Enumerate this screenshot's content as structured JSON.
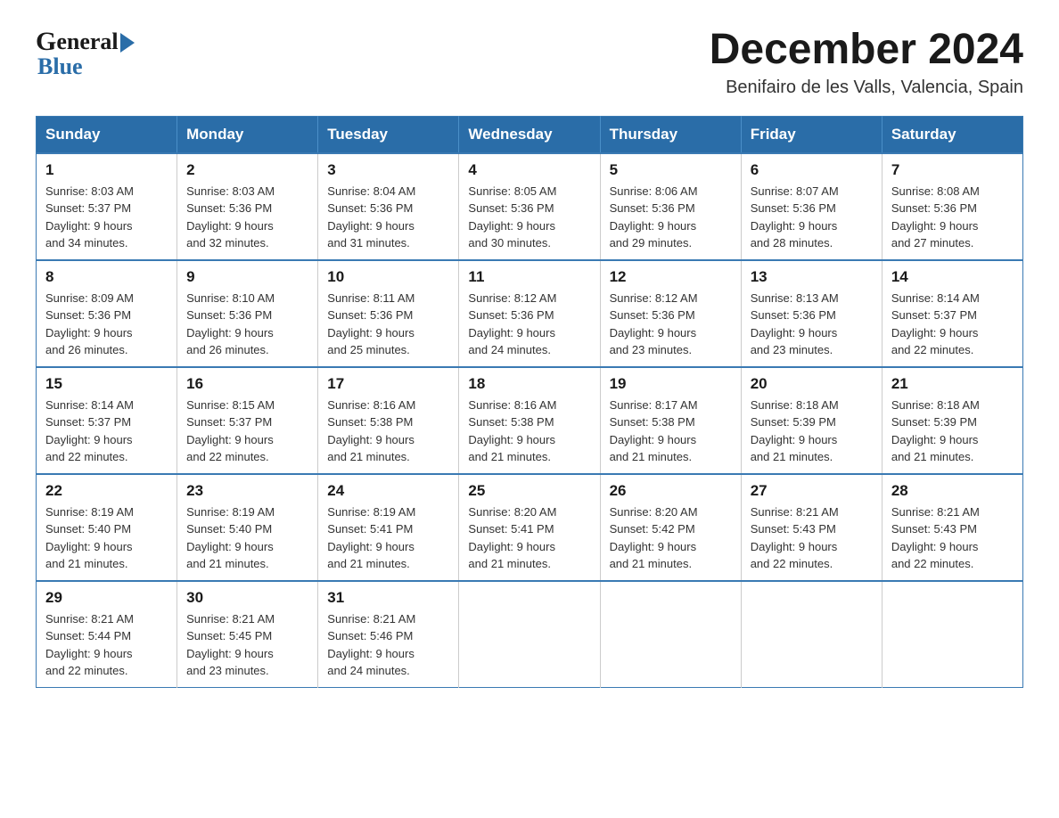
{
  "header": {
    "title": "December 2024",
    "subtitle": "Benifairo de les Valls, Valencia, Spain",
    "logo_general": "General",
    "logo_blue": "Blue"
  },
  "days_of_week": [
    "Sunday",
    "Monday",
    "Tuesday",
    "Wednesday",
    "Thursday",
    "Friday",
    "Saturday"
  ],
  "weeks": [
    [
      {
        "day": "1",
        "sunrise": "8:03 AM",
        "sunset": "5:37 PM",
        "daylight": "9 hours and 34 minutes."
      },
      {
        "day": "2",
        "sunrise": "8:03 AM",
        "sunset": "5:36 PM",
        "daylight": "9 hours and 32 minutes."
      },
      {
        "day": "3",
        "sunrise": "8:04 AM",
        "sunset": "5:36 PM",
        "daylight": "9 hours and 31 minutes."
      },
      {
        "day": "4",
        "sunrise": "8:05 AM",
        "sunset": "5:36 PM",
        "daylight": "9 hours and 30 minutes."
      },
      {
        "day": "5",
        "sunrise": "8:06 AM",
        "sunset": "5:36 PM",
        "daylight": "9 hours and 29 minutes."
      },
      {
        "day": "6",
        "sunrise": "8:07 AM",
        "sunset": "5:36 PM",
        "daylight": "9 hours and 28 minutes."
      },
      {
        "day": "7",
        "sunrise": "8:08 AM",
        "sunset": "5:36 PM",
        "daylight": "9 hours and 27 minutes."
      }
    ],
    [
      {
        "day": "8",
        "sunrise": "8:09 AM",
        "sunset": "5:36 PM",
        "daylight": "9 hours and 26 minutes."
      },
      {
        "day": "9",
        "sunrise": "8:10 AM",
        "sunset": "5:36 PM",
        "daylight": "9 hours and 26 minutes."
      },
      {
        "day": "10",
        "sunrise": "8:11 AM",
        "sunset": "5:36 PM",
        "daylight": "9 hours and 25 minutes."
      },
      {
        "day": "11",
        "sunrise": "8:12 AM",
        "sunset": "5:36 PM",
        "daylight": "9 hours and 24 minutes."
      },
      {
        "day": "12",
        "sunrise": "8:12 AM",
        "sunset": "5:36 PM",
        "daylight": "9 hours and 23 minutes."
      },
      {
        "day": "13",
        "sunrise": "8:13 AM",
        "sunset": "5:36 PM",
        "daylight": "9 hours and 23 minutes."
      },
      {
        "day": "14",
        "sunrise": "8:14 AM",
        "sunset": "5:37 PM",
        "daylight": "9 hours and 22 minutes."
      }
    ],
    [
      {
        "day": "15",
        "sunrise": "8:14 AM",
        "sunset": "5:37 PM",
        "daylight": "9 hours and 22 minutes."
      },
      {
        "day": "16",
        "sunrise": "8:15 AM",
        "sunset": "5:37 PM",
        "daylight": "9 hours and 22 minutes."
      },
      {
        "day": "17",
        "sunrise": "8:16 AM",
        "sunset": "5:38 PM",
        "daylight": "9 hours and 21 minutes."
      },
      {
        "day": "18",
        "sunrise": "8:16 AM",
        "sunset": "5:38 PM",
        "daylight": "9 hours and 21 minutes."
      },
      {
        "day": "19",
        "sunrise": "8:17 AM",
        "sunset": "5:38 PM",
        "daylight": "9 hours and 21 minutes."
      },
      {
        "day": "20",
        "sunrise": "8:18 AM",
        "sunset": "5:39 PM",
        "daylight": "9 hours and 21 minutes."
      },
      {
        "day": "21",
        "sunrise": "8:18 AM",
        "sunset": "5:39 PM",
        "daylight": "9 hours and 21 minutes."
      }
    ],
    [
      {
        "day": "22",
        "sunrise": "8:19 AM",
        "sunset": "5:40 PM",
        "daylight": "9 hours and 21 minutes."
      },
      {
        "day": "23",
        "sunrise": "8:19 AM",
        "sunset": "5:40 PM",
        "daylight": "9 hours and 21 minutes."
      },
      {
        "day": "24",
        "sunrise": "8:19 AM",
        "sunset": "5:41 PM",
        "daylight": "9 hours and 21 minutes."
      },
      {
        "day": "25",
        "sunrise": "8:20 AM",
        "sunset": "5:41 PM",
        "daylight": "9 hours and 21 minutes."
      },
      {
        "day": "26",
        "sunrise": "8:20 AM",
        "sunset": "5:42 PM",
        "daylight": "9 hours and 21 minutes."
      },
      {
        "day": "27",
        "sunrise": "8:21 AM",
        "sunset": "5:43 PM",
        "daylight": "9 hours and 22 minutes."
      },
      {
        "day": "28",
        "sunrise": "8:21 AM",
        "sunset": "5:43 PM",
        "daylight": "9 hours and 22 minutes."
      }
    ],
    [
      {
        "day": "29",
        "sunrise": "8:21 AM",
        "sunset": "5:44 PM",
        "daylight": "9 hours and 22 minutes."
      },
      {
        "day": "30",
        "sunrise": "8:21 AM",
        "sunset": "5:45 PM",
        "daylight": "9 hours and 23 minutes."
      },
      {
        "day": "31",
        "sunrise": "8:21 AM",
        "sunset": "5:46 PM",
        "daylight": "9 hours and 24 minutes."
      },
      null,
      null,
      null,
      null
    ]
  ],
  "labels": {
    "sunrise": "Sunrise:",
    "sunset": "Sunset:",
    "daylight": "Daylight:"
  }
}
